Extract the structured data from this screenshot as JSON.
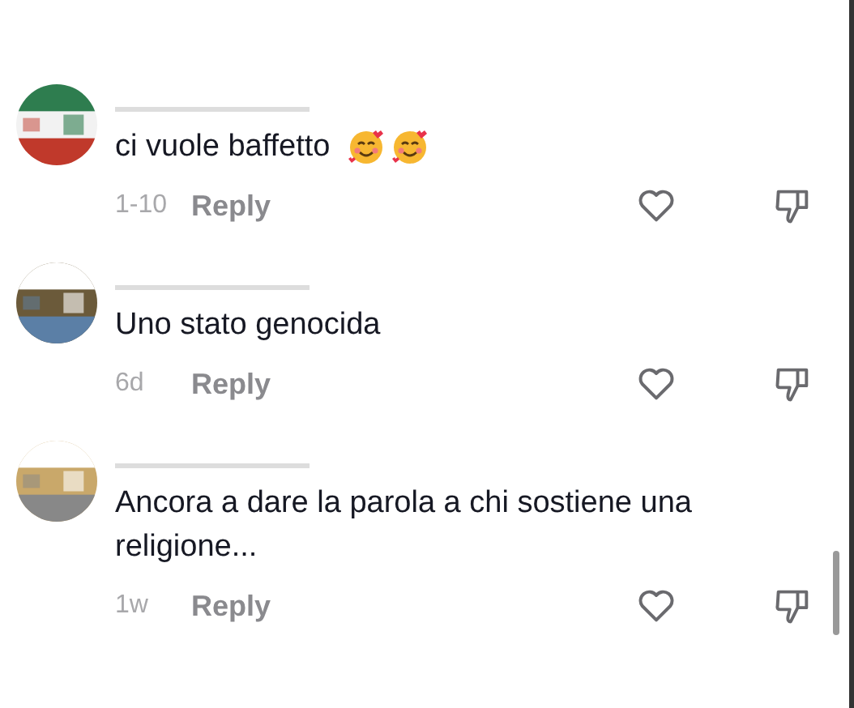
{
  "comments": [
    {
      "avatar": {
        "kind": "picture"
      },
      "text": "ci vuole baffetto",
      "emojis": [
        {
          "kind": "face-with-hearts"
        },
        {
          "kind": "face-with-hearts"
        }
      ],
      "time": "1-10",
      "reply": "Reply"
    },
    {
      "avatar": {
        "kind": "picture"
      },
      "text": "Uno stato genocida",
      "time": "6d",
      "reply": "Reply"
    },
    {
      "avatar": {
        "kind": "picture"
      },
      "text": "Ancora a dare la parola a chi sostiene una religione...",
      "time": "1w",
      "reply": "Reply"
    }
  ]
}
